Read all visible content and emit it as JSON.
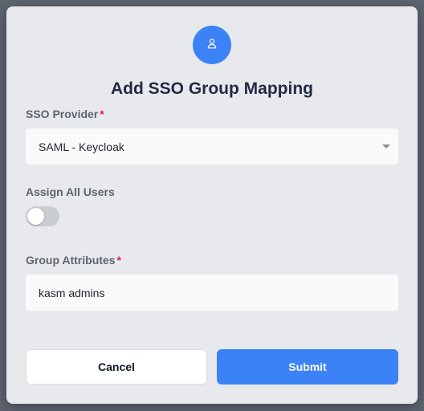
{
  "dialog": {
    "title": "Add SSO Group Mapping",
    "icon": "user-icon",
    "accent_color": "#3b82f6"
  },
  "form": {
    "sso_provider": {
      "label": "SSO Provider",
      "required_marker": "*",
      "value": "SAML - Keycloak"
    },
    "assign_all_users": {
      "label": "Assign All Users",
      "enabled": false
    },
    "group_attributes": {
      "label": "Group Attributes",
      "required_marker": "*",
      "value": "kasm admins"
    }
  },
  "actions": {
    "cancel_label": "Cancel",
    "submit_label": "Submit"
  }
}
